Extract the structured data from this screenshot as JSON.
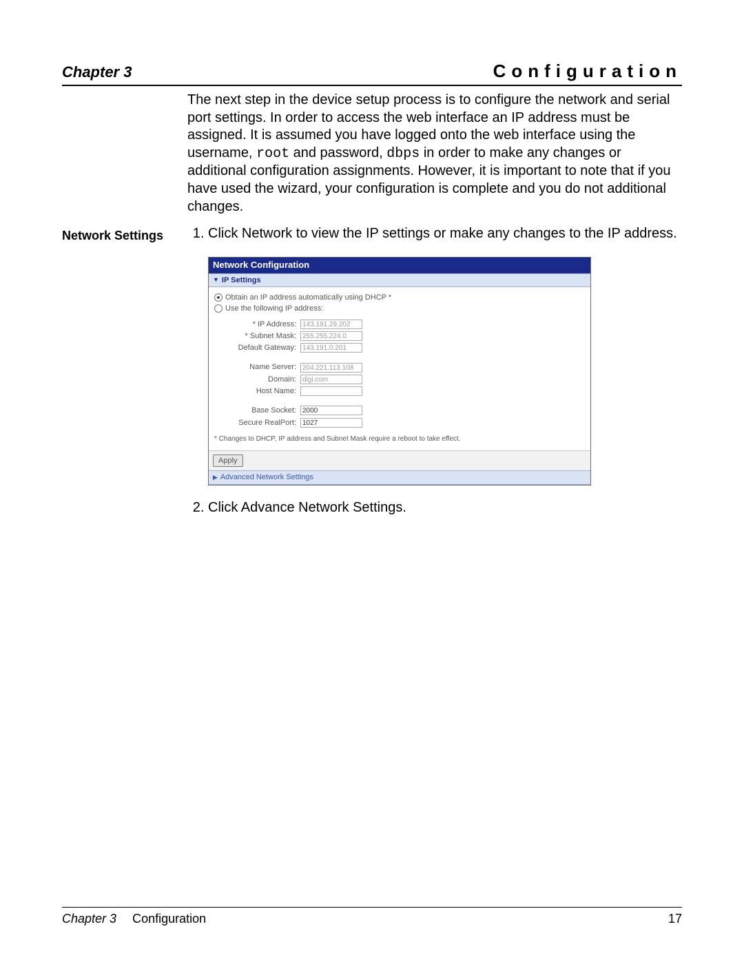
{
  "header": {
    "chapter_label": "Chapter 3",
    "title": "Configuration"
  },
  "intro": {
    "text_before_root": "The next step in the device setup process is to configure the network and serial port settings. In order to access the web interface an IP address must be assigned. It is assumed you have logged onto the web interface using the username, ",
    "root": "root",
    "text_mid": " and password, ",
    "dbps": "dbps",
    "text_after_dbps": " in order to make any changes or additional configuration assignments. However, it is important to note that if you have used the wizard, your configuration is complete and you do not additional changes."
  },
  "section": {
    "side_label": "Network Settings",
    "step1": "Click Network to view the IP settings or make any changes to the IP address.",
    "step2": "Click Advance Network Settings."
  },
  "panel": {
    "title": "Network Configuration",
    "section_ip": "IP Settings",
    "radio_dhcp": "Obtain an IP address automatically using DHCP *",
    "radio_static": "Use the following IP address:",
    "labels": {
      "ip": "* IP Address:",
      "subnet": "* Subnet Mask:",
      "gateway": "Default Gateway:",
      "ns": "Name Server:",
      "domain": "Domain:",
      "host": "Host Name:",
      "base": "Base Socket:",
      "secure": "Secure RealPort:"
    },
    "values": {
      "ip": "143.191.29.202",
      "subnet": "255.255.224.0",
      "gateway": "143.191.0.201",
      "ns": "204.221.113.108",
      "domain": "digi.com",
      "host": "",
      "base": "2000",
      "secure": "1027"
    },
    "footnote": "* Changes to DHCP, IP address and Subnet Mask require a reboot to take effect.",
    "apply": "Apply",
    "section_adv": "Advanced Network Settings"
  },
  "footer": {
    "chapter": "Chapter 3",
    "section": "Configuration",
    "page": "17"
  }
}
